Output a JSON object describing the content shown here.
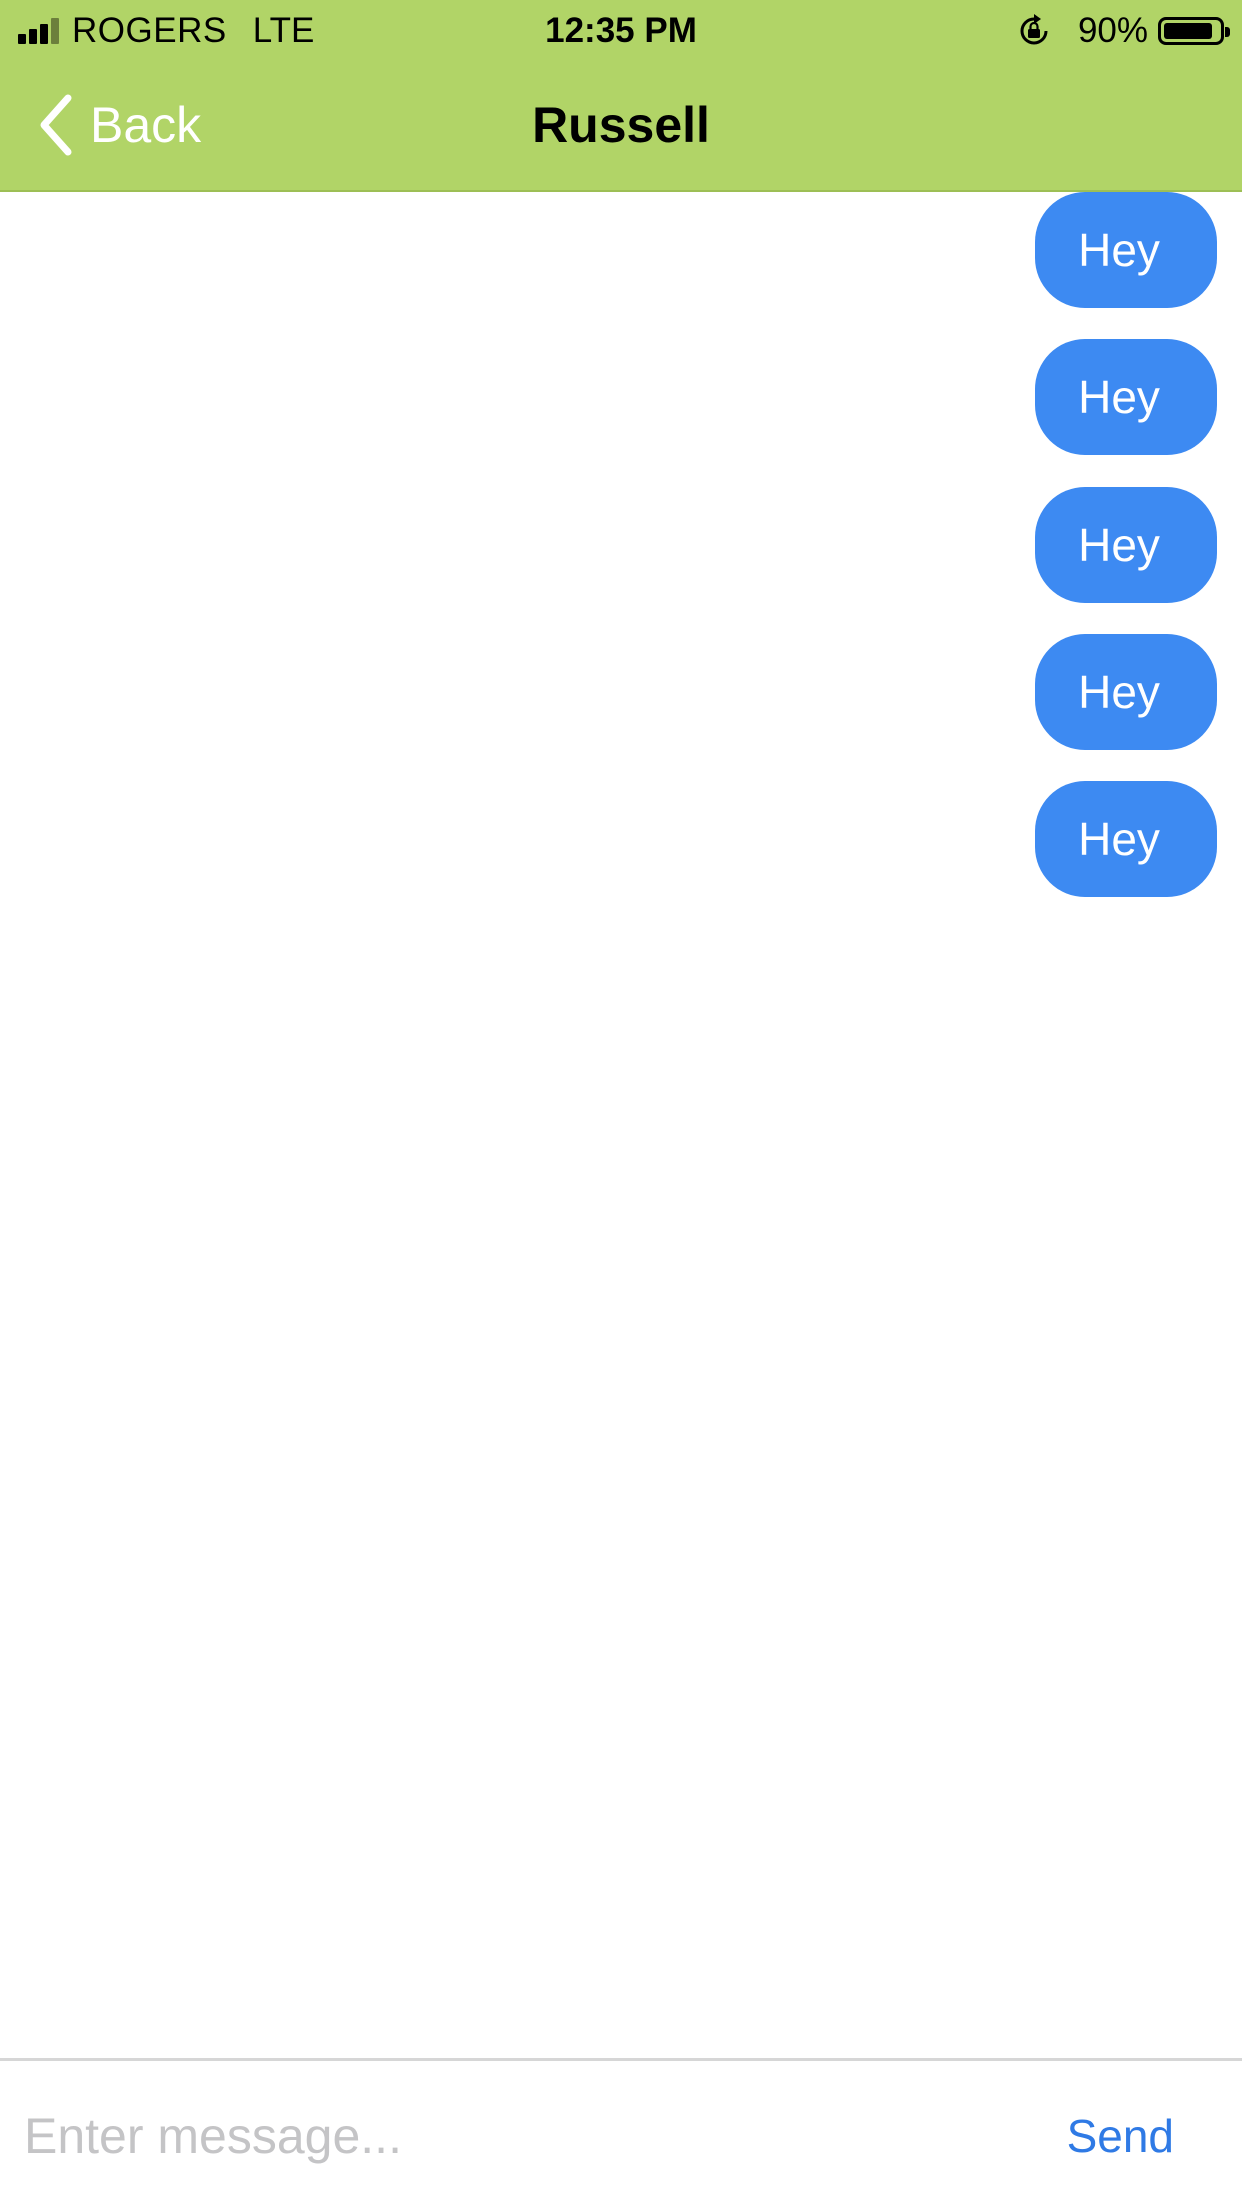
{
  "status_bar": {
    "carrier": "ROGERS",
    "network": "LTE",
    "time": "12:35 PM",
    "battery_percent": "90%",
    "battery_level": 0.9,
    "signal_bars": 3,
    "signal_bars_total": 4
  },
  "nav": {
    "back_label": "Back",
    "title": "Russell"
  },
  "messages": [
    {
      "text": "Hey",
      "direction": "outgoing"
    },
    {
      "text": "Hey",
      "direction": "outgoing"
    },
    {
      "text": "Hey",
      "direction": "outgoing"
    },
    {
      "text": "Hey",
      "direction": "outgoing"
    },
    {
      "text": "Hey",
      "direction": "outgoing"
    }
  ],
  "composer": {
    "value": "",
    "placeholder": "Enter message...",
    "send_label": "Send"
  },
  "colors": {
    "header_bg": "#b1d467",
    "bubble_bg": "#3d8af2",
    "send_text": "#2f7ae5"
  },
  "icons": {
    "signal": "signal-strength-icon",
    "rotation_lock": "rotation-lock-icon",
    "battery": "battery-icon",
    "back": "chevron-left-icon"
  }
}
